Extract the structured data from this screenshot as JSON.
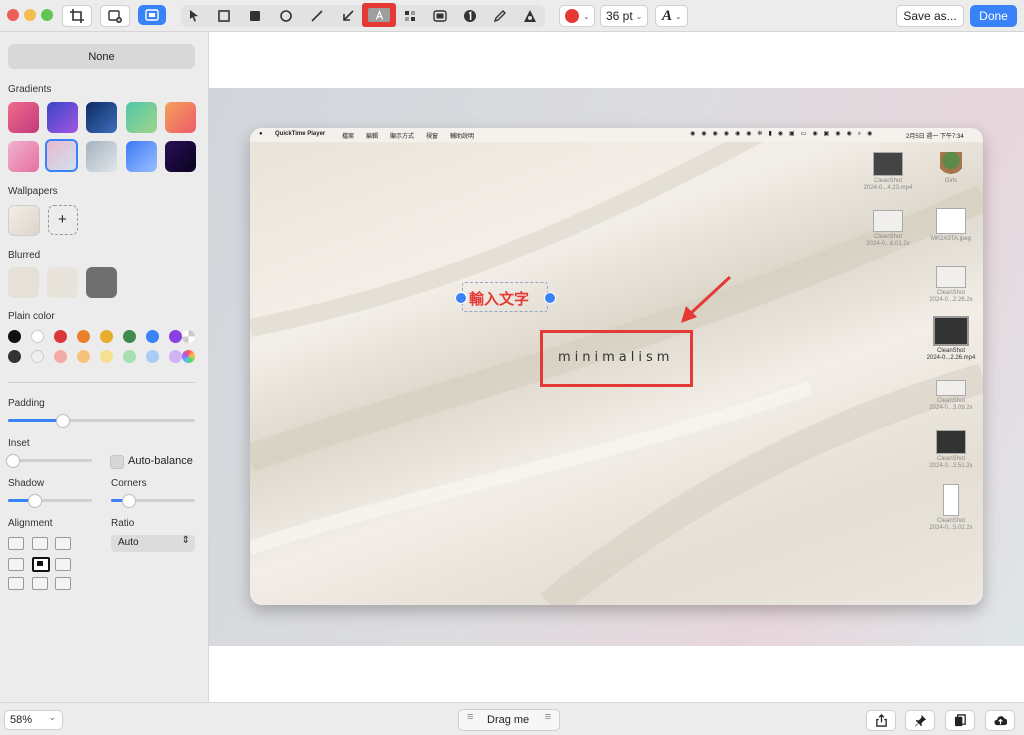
{
  "toolbar": {
    "font_size": "36 pt",
    "save_label": "Save as...",
    "done_label": "Done",
    "colors": {
      "close": "#ed5f58",
      "minimize": "#f5bd4f",
      "maximize": "#61c554",
      "accent": "#3a82f7",
      "highlight": "#e53935",
      "pen": "#e53935"
    }
  },
  "sidebar": {
    "none_label": "None",
    "gradients_label": "Gradients",
    "wallpapers_label": "Wallpapers",
    "blurred_label": "Blurred",
    "plain_color_label": "Plain color",
    "padding_label": "Padding",
    "inset_label": "Inset",
    "auto_balance_label": "Auto-balance",
    "shadow_label": "Shadow",
    "corners_label": "Corners",
    "alignment_label": "Alignment",
    "ratio_label": "Ratio",
    "ratio_value": "Auto",
    "padding_value": 0.29,
    "inset_value": 0.05,
    "shadow_value": 0.31,
    "corners_value": 0.2
  },
  "screenshot": {
    "menubar_app": "QuickTime Player",
    "menubar_menus": [
      "檔案",
      "編輯",
      "顯示方式",
      "視窗",
      "輔助說明"
    ],
    "menubar_clock": "2月5日 週一 下午7:34",
    "text_annotation": "輸入文字",
    "word": "minimalism",
    "desktop_icons": [
      {
        "line1": "CleanShot",
        "line2": "2024-0...4.23.mp4"
      },
      {
        "line1": "Girls",
        "line2": ""
      },
      {
        "line1": "CleanShot",
        "line2": "2024-0...6.01.2x"
      },
      {
        "line1": "MK2A3TA.jpeg",
        "line2": ""
      },
      {
        "line1": "CleanShot",
        "line2": "2024-0...2.26.2x"
      },
      {
        "line1": "CleanShot",
        "line2": "2024-0...2.26.mp4"
      },
      {
        "line1": "CleanShot",
        "line2": "2024-0...3.09.2x"
      },
      {
        "line1": "CleanShot",
        "line2": "2024-0...3.51.2x"
      },
      {
        "line1": "CleanShot",
        "line2": "2024-0...5.02.2x"
      }
    ]
  },
  "bottombar": {
    "zoom": "58%",
    "drag_label": "Drag me"
  }
}
